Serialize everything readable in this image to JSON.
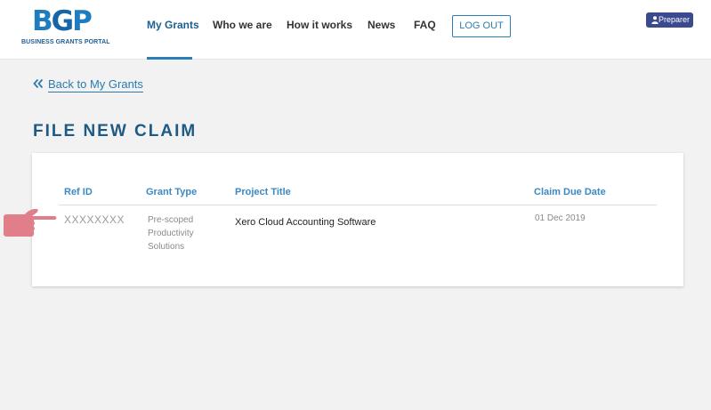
{
  "header": {
    "logo_text_b": "B",
    "logo_text_g": "G",
    "logo_text_p": "P",
    "logo_subtitle": "BUSINESS GRANTS PORTAL",
    "nav": [
      "My Grants",
      "Who we are",
      "How it works",
      "News",
      "FAQ"
    ],
    "logout_label": "LOG OUT",
    "role_badge": "Preparer"
  },
  "back_link": "Back to My Grants",
  "page_title": "FILE NEW CLAIM",
  "table": {
    "columns": [
      "Ref ID",
      "Grant Type",
      "Project Title",
      "Claim Due Date"
    ],
    "rows": [
      {
        "ref_id": "XXXXXXXX",
        "grant_type_lines": [
          "Pre-scoped",
          "Productivity",
          "Solutions"
        ],
        "project_title": "Xero Cloud Accounting Software",
        "claim_due_date": "01 Dec 2019"
      }
    ]
  },
  "colors": {
    "brand_blue": "#1f7dbf",
    "title_blue": "#1e5a84",
    "badge": "#3b4a8f",
    "pointer": "#e07f8a"
  }
}
